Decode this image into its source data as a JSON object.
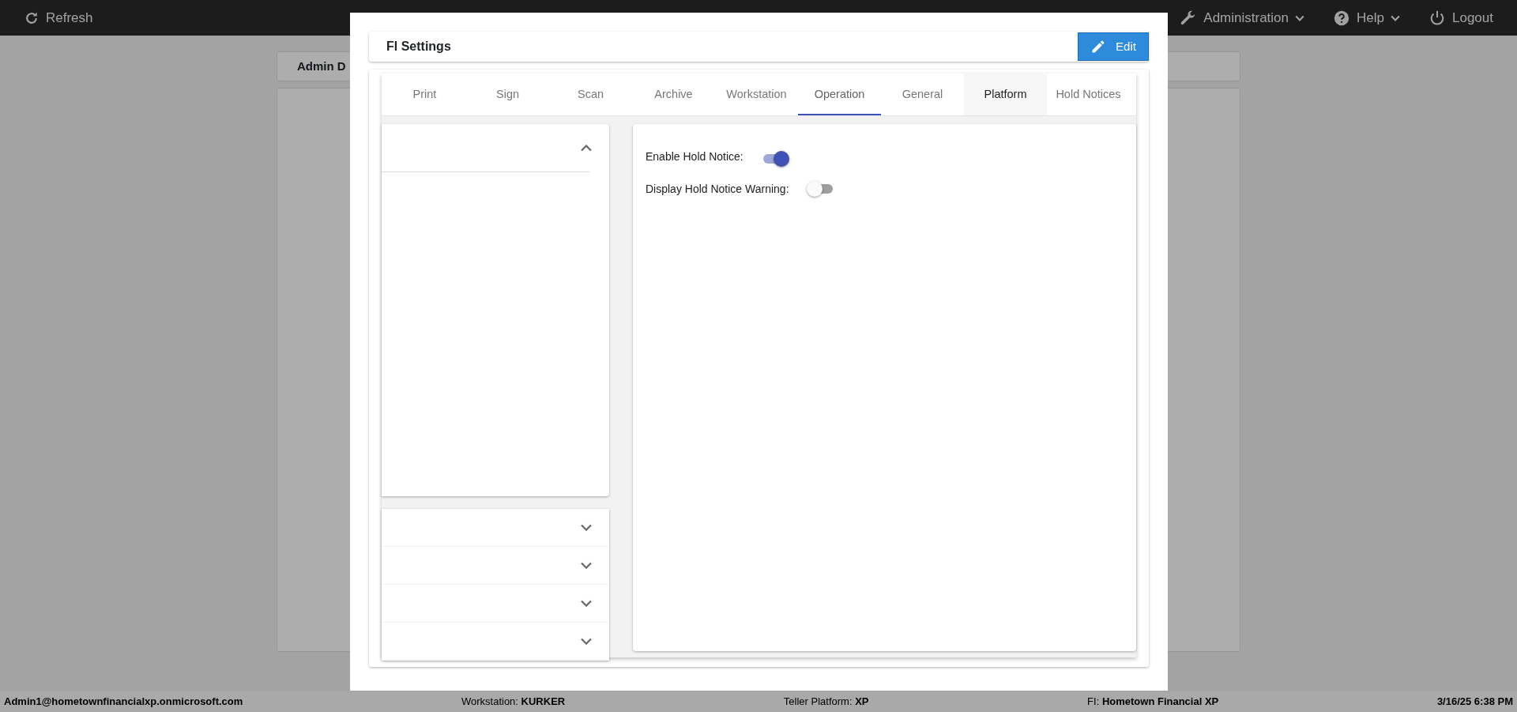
{
  "top_bar": {
    "refresh": "Refresh",
    "menus": [
      {
        "label": "Administration",
        "dropdown": true
      },
      {
        "label": "Help",
        "dropdown": true
      },
      {
        "label": "Logout",
        "dropdown": false
      }
    ]
  },
  "page": {
    "title": "Admin D"
  },
  "modal": {
    "title": "FI Settings",
    "edit_button": "Edit",
    "tabs": [
      {
        "label": "Print",
        "selected": false,
        "hovered": false
      },
      {
        "label": "Sign",
        "selected": false,
        "hovered": false
      },
      {
        "label": "Scan",
        "selected": false,
        "hovered": false
      },
      {
        "label": "Archive",
        "selected": false,
        "hovered": false
      },
      {
        "label": "Workstation",
        "selected": false,
        "hovered": false
      },
      {
        "label": "Operation",
        "selected": true,
        "hovered": false
      },
      {
        "label": "General",
        "selected": false,
        "hovered": false
      },
      {
        "label": "Platform",
        "selected": false,
        "hovered": true
      },
      {
        "label": "Hold Notices",
        "selected": false,
        "hovered": false
      }
    ],
    "panels": [
      {
        "expanded": true
      },
      {
        "expanded": false
      },
      {
        "expanded": false
      },
      {
        "expanded": false
      },
      {
        "expanded": false
      }
    ],
    "settings": [
      {
        "label": "Enable Hold Notice:",
        "on": true
      },
      {
        "label": "Display Hold Notice Warning:",
        "on": false
      }
    ]
  },
  "status_bar": [
    {
      "value": "Admin1@hometownfinancialxp.onmicrosoft.com"
    },
    {
      "label": "Workstation:",
      "value": "KURKER"
    },
    {
      "label": "Teller Platform:",
      "value": "XP"
    },
    {
      "label": "FI:",
      "value": "Hometown Financial XP"
    },
    {
      "value": "3/16/25 6:38 PM"
    }
  ]
}
